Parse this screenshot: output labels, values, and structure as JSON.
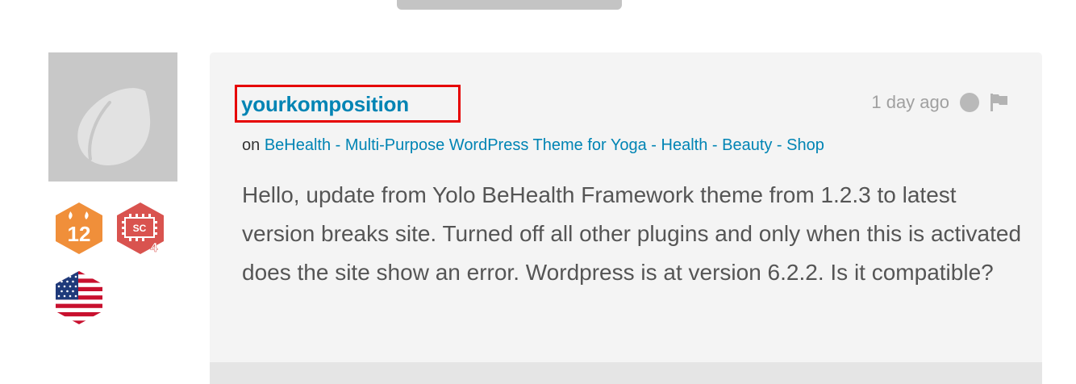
{
  "comment": {
    "username": "yourkomposition",
    "on_prefix": "on",
    "item_title": "BeHealth - Multi-Purpose WordPress Theme for Yoga - Health - Beauty - Shop",
    "timestamp": "1 day ago",
    "body": "Hello, update from Yolo BeHealth Framework theme from 1.2.3 to latest version breaks site. Turned off all other plugins and only when this is activated does the site show an error. Wordpress is at version 6.2.2. Is it compatible?"
  },
  "badges": [
    {
      "icon": "years-badge-icon",
      "label": "12",
      "color": "#f08f3a"
    },
    {
      "icon": "sales-badge-icon",
      "label": "SC",
      "level": "4",
      "color": "#d9534f"
    },
    {
      "icon": "us-flag-icon"
    }
  ],
  "colors": {
    "link": "#0084b4",
    "highlight": "#e60000",
    "card_bg": "#f4f4f4",
    "avatar_bg": "#c8c8c8"
  }
}
